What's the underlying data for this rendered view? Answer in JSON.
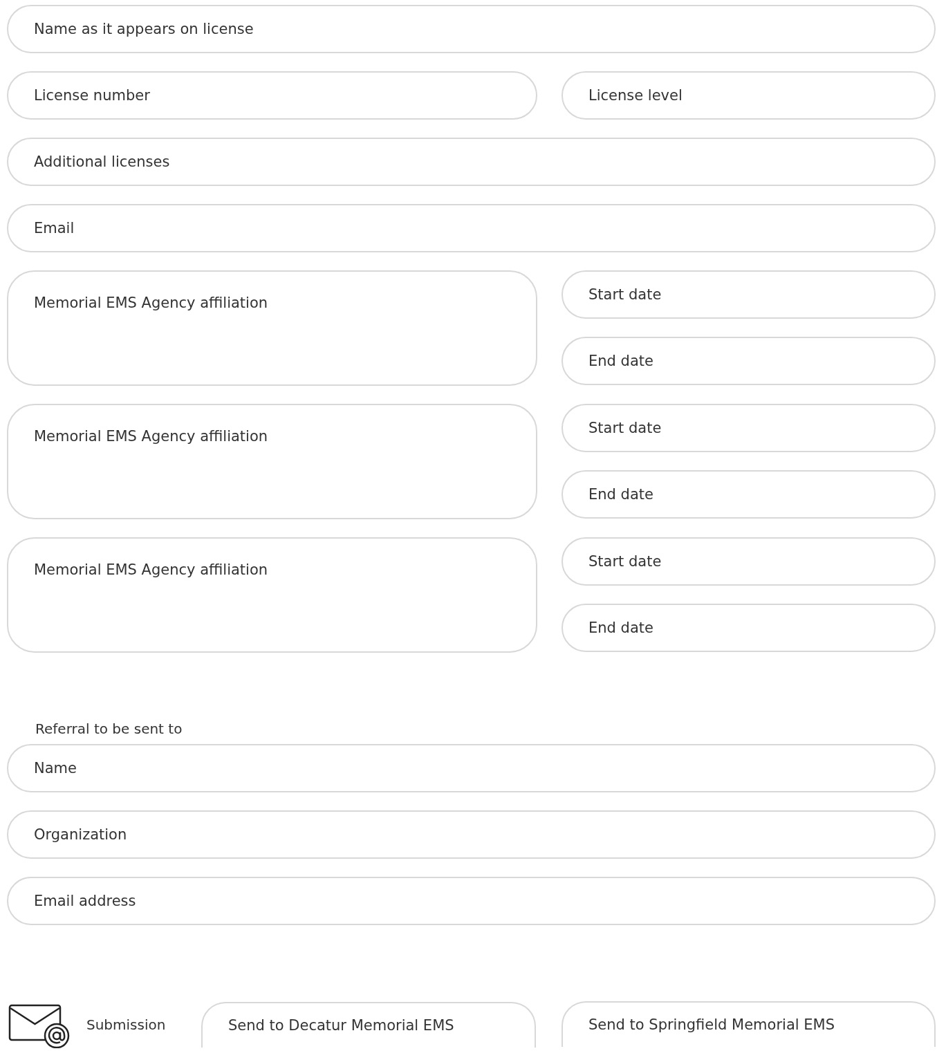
{
  "license": {
    "name": {
      "placeholder": "Name as it appears on license"
    },
    "license_number": {
      "placeholder": "License number"
    },
    "license_level": {
      "placeholder": "License level"
    },
    "additional_licenses": {
      "placeholder": "Additional licenses"
    },
    "email": {
      "placeholder": "Email"
    }
  },
  "affiliations": [
    {
      "agency": {
        "placeholder": "Memorial EMS Agency affiliation"
      },
      "start_date": {
        "placeholder": "Start date"
      },
      "end_date": {
        "placeholder": "End date"
      }
    },
    {
      "agency": {
        "placeholder": "Memorial EMS Agency affiliation"
      },
      "start_date": {
        "placeholder": "Start date"
      },
      "end_date": {
        "placeholder": "End date"
      }
    },
    {
      "agency": {
        "placeholder": "Memorial EMS Agency affiliation"
      },
      "start_date": {
        "placeholder": "Start date"
      },
      "end_date": {
        "placeholder": "End date"
      }
    }
  ],
  "referral": {
    "heading": "Referral to be sent to",
    "name": {
      "placeholder": "Name"
    },
    "organization": {
      "placeholder": "Organization"
    },
    "email_address": {
      "placeholder": "Email address"
    }
  },
  "submission": {
    "label": "Submission",
    "buttons": [
      "Send to Decatur Memorial EMS",
      "Send to Springfield Memorial EMS"
    ]
  }
}
